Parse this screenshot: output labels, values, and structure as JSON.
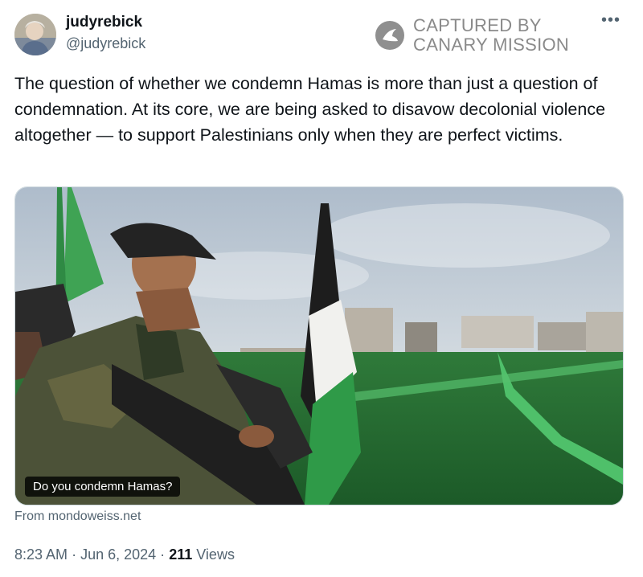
{
  "author": {
    "name": "judyrebick",
    "handle": "@judyrebick"
  },
  "watermark": {
    "line1": "CAPTURED BY",
    "line2": "CANARY MISSION"
  },
  "tweet": {
    "text": "The question of whether we condemn Hamas is more than just a question of condemnation. At its core, we are being asked to disavow decolonial violence altogether — to support Palestinians only when they are perfect victims."
  },
  "card": {
    "caption": "Do you condemn Hamas?",
    "source": "From mondoweiss.net"
  },
  "meta": {
    "time": "8:23 AM",
    "separator": "·",
    "date": "Jun 6, 2024",
    "views_count": "211",
    "views_label": "Views"
  },
  "icons": {
    "more": "more-dots-icon",
    "watermark": "canary-logo-icon"
  }
}
